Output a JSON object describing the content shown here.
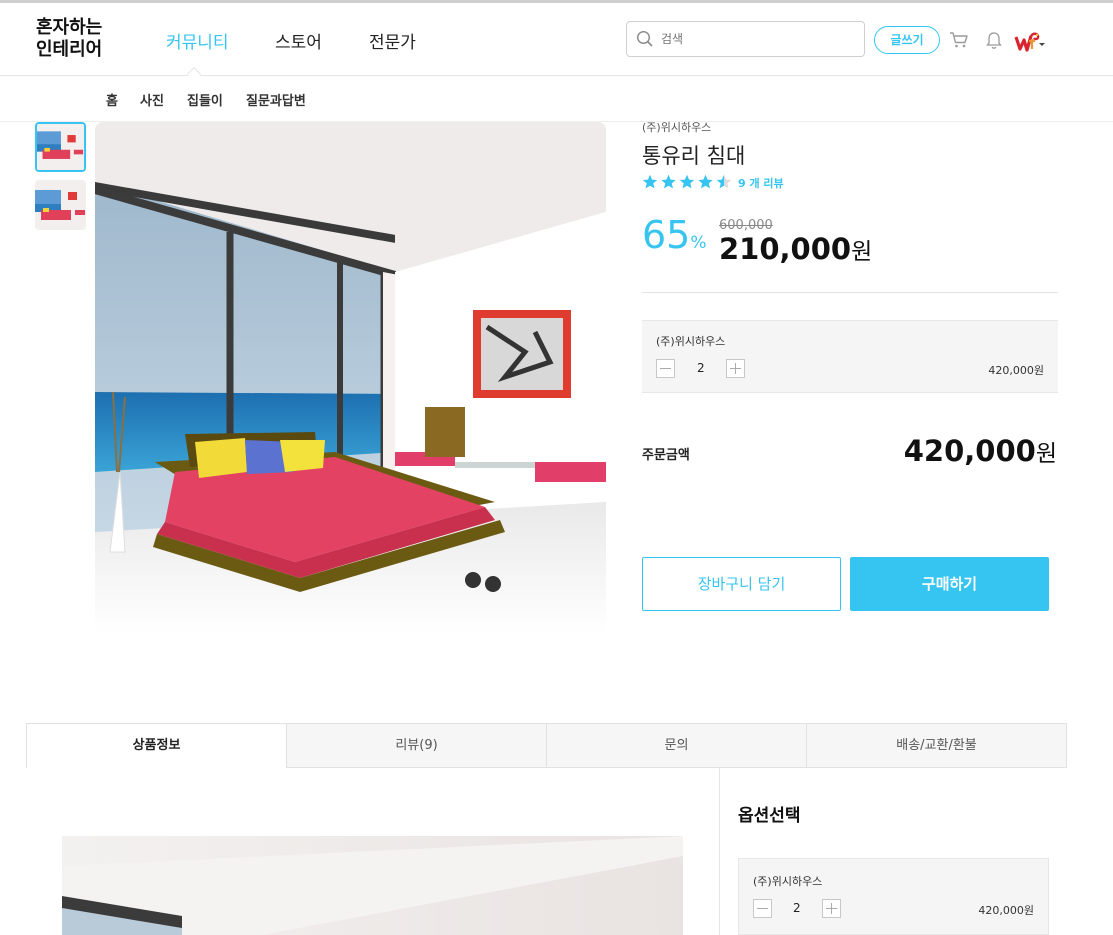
{
  "header": {
    "logo": [
      "혼자하는",
      "인테리어"
    ],
    "nav": [
      "커뮤니티",
      "스토어",
      "전문가"
    ],
    "search_placeholder": "검색",
    "write_label": "글쓰기"
  },
  "subnav": [
    "홈",
    "사진",
    "집들이",
    "질문과답변"
  ],
  "product": {
    "brand": "(주)위시하우스",
    "title": "통유리 침대",
    "rating": 4.5,
    "review_count": "9 개 리뷰",
    "discount": "65",
    "discount_unit": "%",
    "original_price": "600,000",
    "price": "210,000",
    "currency": "원"
  },
  "option": {
    "name": "(주)위시하우스",
    "quantity": "2",
    "price": "420,000원"
  },
  "order": {
    "total_label": "주문금액",
    "total": "420,000",
    "currency": "원"
  },
  "buttons": {
    "cart": "장바구니 담기",
    "buy": "구매하기"
  },
  "tabs": [
    "상품정보",
    "리뷰(9)",
    "문의",
    "배송/교환/환불"
  ],
  "sidebar": {
    "title": "옵션선택",
    "option_name": "(주)위시하우스",
    "quantity": "2",
    "price": "420,000원"
  },
  "colors": {
    "accent": "#35c5f0"
  }
}
